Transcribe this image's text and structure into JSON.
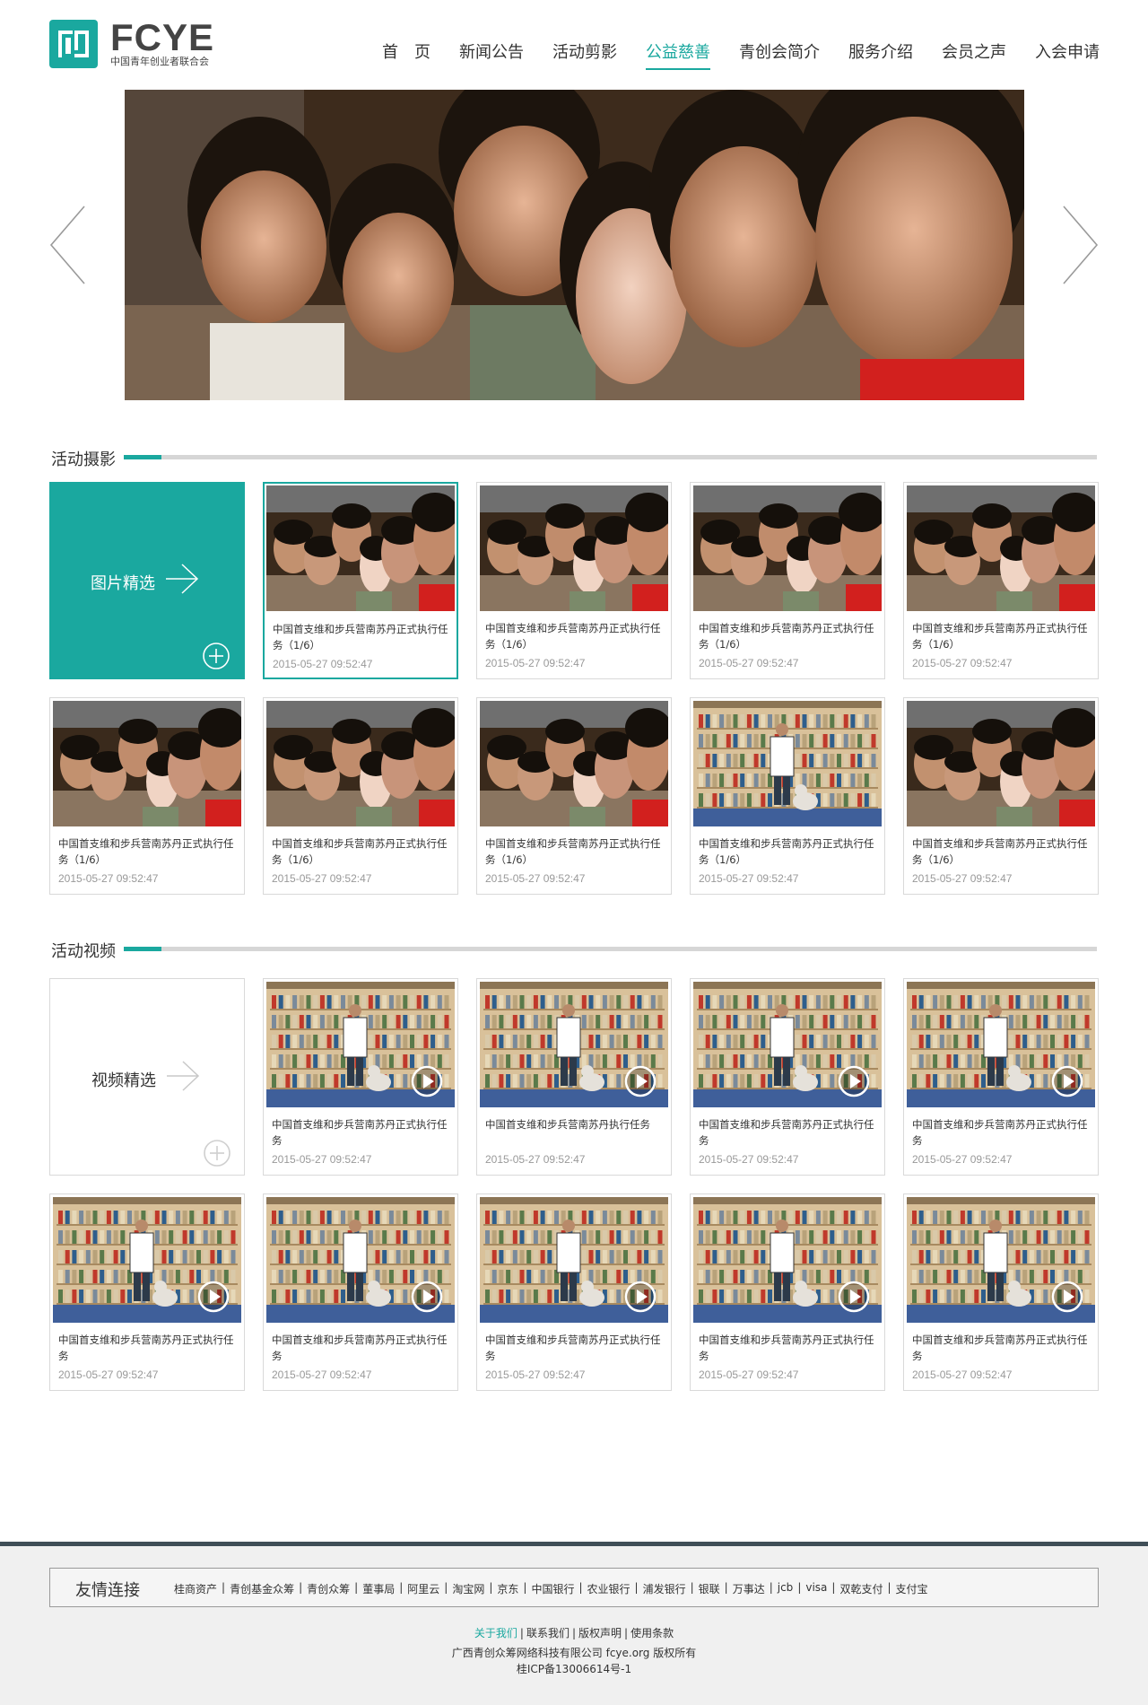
{
  "brand": {
    "name_en": "FCYE",
    "name_cn": "中国青年创业者联合会",
    "accent_color": "#1aa89f"
  },
  "nav": {
    "items": [
      {
        "label": "首　页"
      },
      {
        "label": "新闻公告"
      },
      {
        "label": "活动剪影"
      },
      {
        "label": "公益慈善",
        "active": true
      },
      {
        "label": "青创会简介"
      },
      {
        "label": "服务介绍"
      },
      {
        "label": "会员之声"
      },
      {
        "label": "入会申请"
      }
    ]
  },
  "banner": {
    "prev_icon": "chevron-left-icon",
    "next_icon": "chevron-right-icon"
  },
  "photos": {
    "title": "活动摄影",
    "feature_label": "图片精选",
    "items": [
      {
        "caption": "中国首支维和步兵营南苏丹正式执行任务（1/6）",
        "date": "2015-05-27 09:52:47",
        "image": "children"
      },
      {
        "caption": "中国首支维和步兵营南苏丹正式执行任务（1/6）",
        "date": "2015-05-27 09:52:47",
        "image": "children"
      },
      {
        "caption": "中国首支维和步兵营南苏丹正式执行任务（1/6）",
        "date": "2015-05-27 09:52:47",
        "image": "children"
      },
      {
        "caption": "中国首支维和步兵营南苏丹正式执行任务（1/6）",
        "date": "2015-05-27 09:52:47",
        "image": "children"
      },
      {
        "caption": "中国首支维和步兵营南苏丹正式执行任务（1/6）",
        "date": "2015-05-27 09:52:47",
        "image": "children"
      },
      {
        "caption": "中国首支维和步兵营南苏丹正式执行任务（1/6）",
        "date": "2015-05-27 09:52:47",
        "image": "children"
      },
      {
        "caption": "中国首支维和步兵营南苏丹正式执行任务（1/6）",
        "date": "2015-05-27 09:52:47",
        "image": "children"
      },
      {
        "caption": "中国首支维和步兵营南苏丹正式执行任务（1/6）",
        "date": "2015-05-27 09:52:47",
        "image": "bookshelf"
      },
      {
        "caption": "中国首支维和步兵营南苏丹正式执行任务（1/6）",
        "date": "2015-05-27 09:52:47",
        "image": "children"
      }
    ]
  },
  "videos": {
    "title": "活动视频",
    "feature_label": "视频精选",
    "items": [
      {
        "caption": "中国首支维和步兵营南苏丹正式执行任务",
        "date": "2015-05-27 09:52:47"
      },
      {
        "caption": "中国首支维和步兵营南苏丹执行任务",
        "date": "2015-05-27 09:52:47"
      },
      {
        "caption": "中国首支维和步兵营南苏丹正式执行任务",
        "date": "2015-05-27 09:52:47"
      },
      {
        "caption": "中国首支维和步兵营南苏丹正式执行任务",
        "date": "2015-05-27 09:52:47"
      },
      {
        "caption": "中国首支维和步兵营南苏丹正式执行任务",
        "date": "2015-05-27 09:52:47"
      },
      {
        "caption": "中国首支维和步兵营南苏丹正式执行任务",
        "date": "2015-05-27 09:52:47"
      },
      {
        "caption": "中国首支维和步兵营南苏丹正式执行任务",
        "date": "2015-05-27 09:52:47"
      },
      {
        "caption": "中国首支维和步兵营南苏丹正式执行任务",
        "date": "2015-05-27 09:52:47"
      },
      {
        "caption": "中国首支维和步兵营南苏丹正式执行任务",
        "date": "2015-05-27 09:52:47"
      }
    ]
  },
  "footer": {
    "links_title": "友情连接",
    "links": [
      "桂商资产",
      "青创基金众筹",
      "青创众筹",
      "董事局",
      "阿里云",
      "淘宝网",
      "京东",
      "中国银行",
      "农业银行",
      "浦发银行",
      "银联",
      "万事达",
      "jcb",
      "visa",
      "双乾支付",
      "支付宝"
    ],
    "nav": [
      "关于我们",
      "联系我们",
      "版权声明",
      "使用条款"
    ],
    "copyright": "广西青创众筹网络科技有限公司 fcye.org 版权所有",
    "icp": "桂ICP备13006614号-1"
  }
}
